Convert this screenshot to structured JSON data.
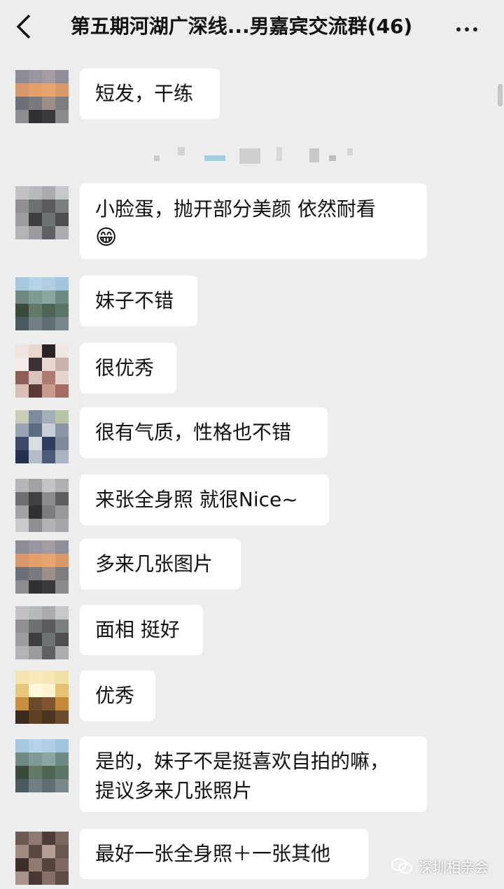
{
  "header": {
    "title": "第五期河湖广深线...男嘉宾交流群(46)",
    "back_icon": "back-arrow-icon",
    "more_icon": "more-icon"
  },
  "messages": [
    {
      "text": "短发，干练"
    },
    {
      "text": "小脸蛋，抛开部分美颜 依然耐看",
      "emoji": "😁"
    },
    {
      "text": "妹子不错"
    },
    {
      "text": "很优秀"
    },
    {
      "text": "很有气质，性格也不错"
    },
    {
      "text": "来张全身照 就很Nice~"
    },
    {
      "text": "多来几张图片"
    },
    {
      "text": "面相 挺好"
    },
    {
      "text": "优秀"
    },
    {
      "text": "是的，妹子不是挺喜欢自拍的嘛，\n提议多来几张照片"
    },
    {
      "text": "最好一张全身照＋一张其他"
    }
  ],
  "watermark": {
    "text": "深圳相亲会"
  }
}
